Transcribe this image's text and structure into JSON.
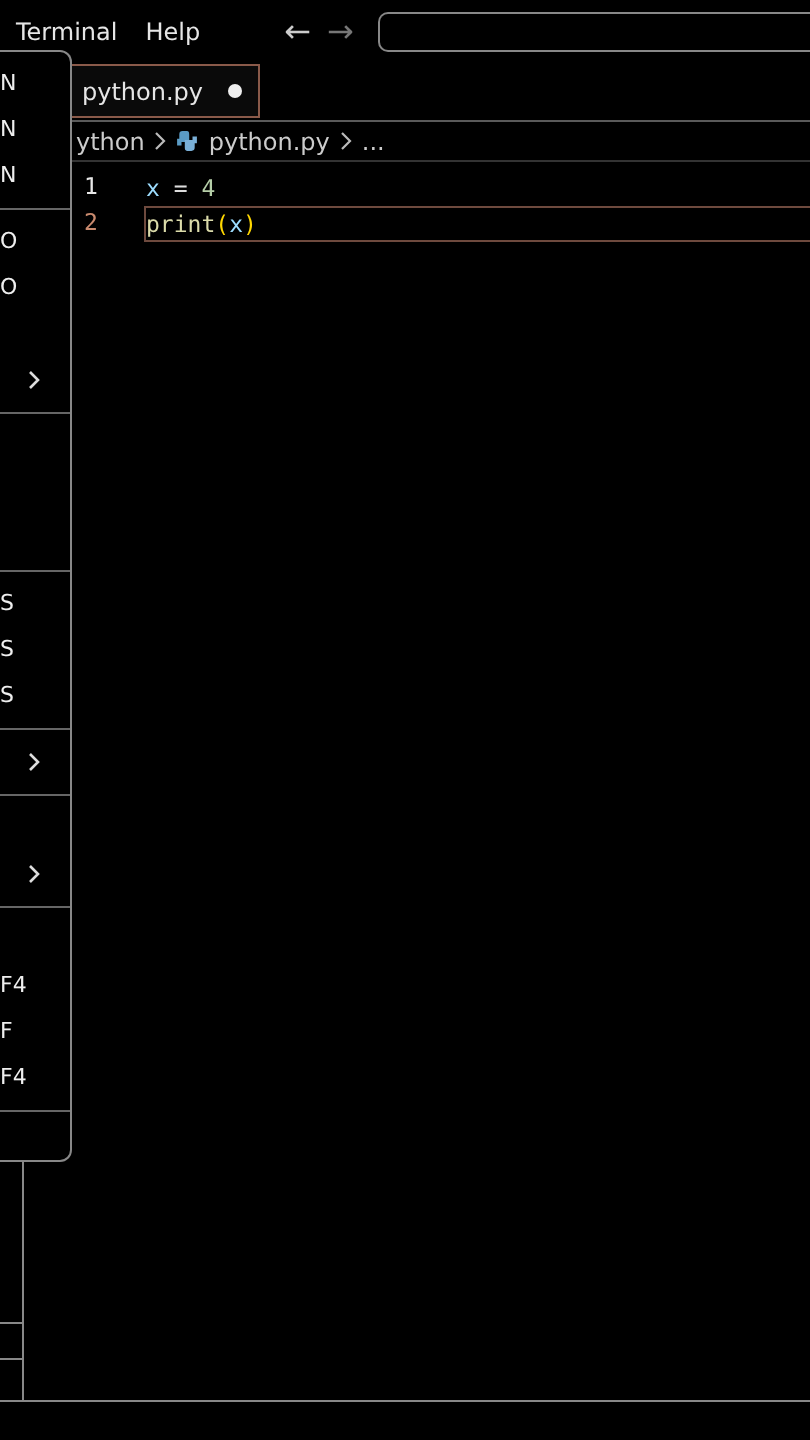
{
  "menubar": [
    {
      "label": "Terminal"
    },
    {
      "label": "Help"
    }
  ],
  "nav": [
    {
      "label": "←",
      "disabled": false
    },
    {
      "label": "→",
      "disabled": true
    }
  ],
  "tabs": [
    {
      "label": "python.py",
      "modified": true,
      "selected": true
    }
  ],
  "breadcrumb": [
    {
      "label": "ython",
      "kind": "folder"
    },
    {
      "label": "python.py",
      "kind": "python"
    },
    {
      "label": "...",
      "kind": "more"
    }
  ],
  "code": [
    {
      "number": "1",
      "color": "#e8e8e8",
      "selected": false,
      "tokens": [
        {
          "text": "x",
          "kind": "var"
        },
        {
          "text": " = ",
          "kind": "op"
        },
        {
          "text": "4",
          "kind": "num"
        }
      ]
    },
    {
      "number": "2",
      "color": "#c98a6e",
      "selected": true,
      "tokens": [
        {
          "text": "print",
          "kind": "func"
        },
        {
          "text": "(",
          "kind": "paren"
        },
        {
          "text": "x",
          "kind": "var"
        },
        {
          "text": ")",
          "kind": "paren"
        }
      ]
    }
  ],
  "menu": [
    [
      {
        "kind": "shortcut",
        "shortcut": "N"
      },
      {
        "kind": "shortcut",
        "shortcut": "N"
      },
      {
        "kind": "shortcut",
        "shortcut": "N"
      }
    ],
    [
      {
        "kind": "shortcut",
        "shortcut": "O"
      },
      {
        "kind": "shortcut",
        "shortcut": "O"
      },
      {
        "kind": "blank"
      },
      {
        "kind": "submenu"
      }
    ],
    [
      {
        "kind": "blank"
      },
      {
        "kind": "blank"
      },
      {
        "kind": "blank"
      }
    ],
    [
      {
        "kind": "shortcut",
        "shortcut": "S"
      },
      {
        "kind": "shortcut",
        "shortcut": "S"
      },
      {
        "kind": "shortcut",
        "shortcut": "S"
      }
    ],
    [
      {
        "kind": "submenu"
      }
    ],
    [
      {
        "kind": "blank"
      },
      {
        "kind": "submenu"
      }
    ],
    [
      {
        "kind": "blank"
      },
      {
        "kind": "shortcut",
        "shortcut": "F4"
      },
      {
        "kind": "shortcut",
        "shortcut": "F"
      },
      {
        "kind": "shortcut",
        "shortcut": "F4"
      }
    ],
    [
      {
        "kind": "blank"
      }
    ]
  ]
}
